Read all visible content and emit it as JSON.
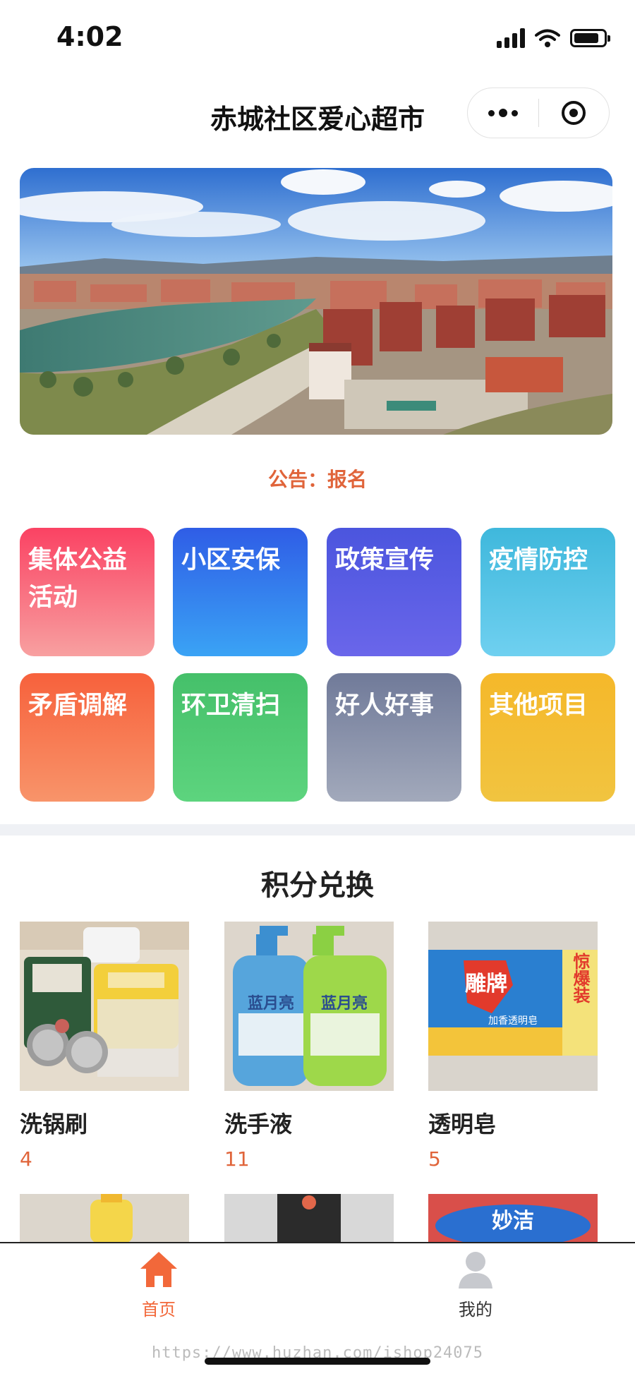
{
  "status_bar": {
    "time": "4:02"
  },
  "nav": {
    "title": "赤城社区爱心超市"
  },
  "notice": {
    "text": "公告：报名"
  },
  "categories": [
    {
      "label": "集体公益活动",
      "color_top": "#fa4263",
      "color_bottom": "#f8a0a0"
    },
    {
      "label": "小区安保",
      "color_top": "#2f5de6",
      "color_bottom": "#3aa3f5"
    },
    {
      "label": "政策宣传",
      "color_top": "#4b55de",
      "color_bottom": "#6a66ea"
    },
    {
      "label": "疫情防控",
      "color_top": "#3fb8dc",
      "color_bottom": "#6fd0f0"
    },
    {
      "label": "矛盾调解",
      "color_top": "#f7613c",
      "color_bottom": "#f8946a"
    },
    {
      "label": "环卫清扫",
      "color_top": "#45c06a",
      "color_bottom": "#5dd47e"
    },
    {
      "label": "好人好事",
      "color_top": "#707a99",
      "color_bottom": "#a2a9bb"
    },
    {
      "label": "其他项目",
      "color_top": "#f5b82a",
      "color_bottom": "#f1c440"
    }
  ],
  "exchange": {
    "title": "积分兑换",
    "products": [
      {
        "name": "洗锅刷",
        "points": "4"
      },
      {
        "name": "洗手液",
        "points": "11"
      },
      {
        "name": "透明皂",
        "points": "5"
      }
    ],
    "product_image_text": {
      "soap_brand": "雕牌",
      "soap_sub": "加香透明皂",
      "soap_promo": "惊爆装",
      "liquid_brand": "蓝月亮",
      "row2_brand": "妙洁"
    }
  },
  "tabbar": {
    "home": "首页",
    "mine": "我的",
    "accent": "#f2683a"
  },
  "watermark": "https://www.huzhan.com/ishop24075"
}
